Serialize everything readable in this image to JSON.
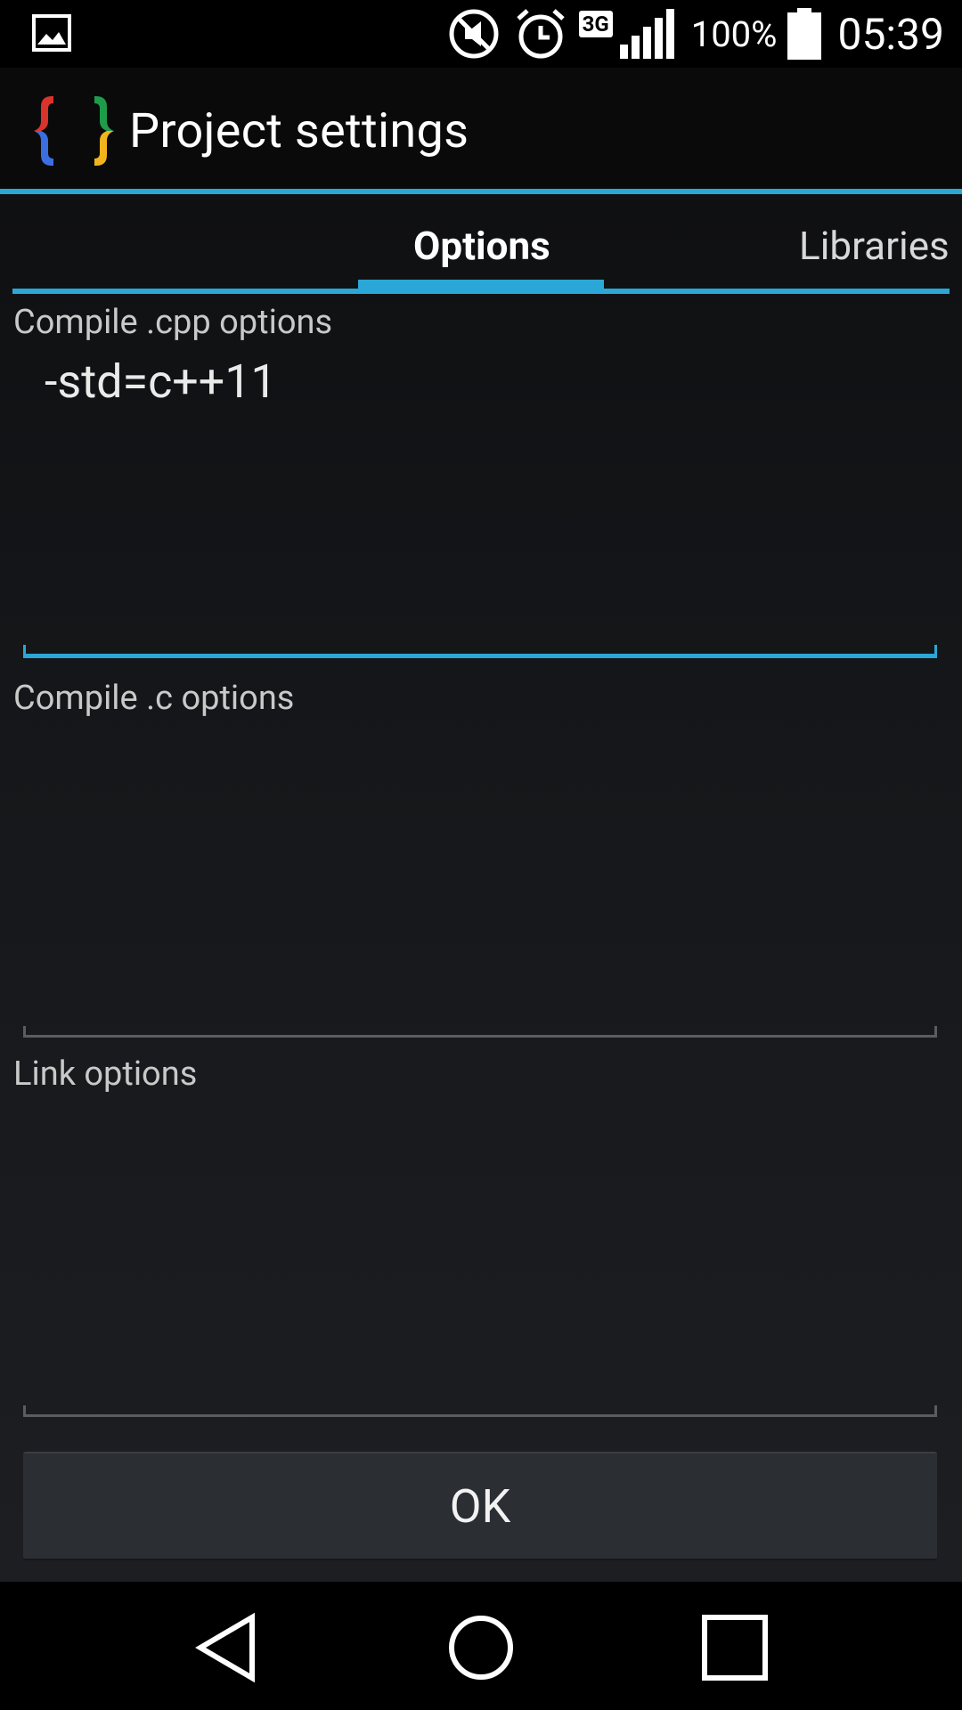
{
  "status_bar": {
    "battery_percent": "100%",
    "time": "05:39",
    "network": "3G",
    "icons": [
      "gallery-icon",
      "mute-icon",
      "alarm-icon",
      "network-3g-icon",
      "signal-icon",
      "battery-icon"
    ]
  },
  "action_bar": {
    "title": "Project settings",
    "logo_icon": "braces-logo-icon"
  },
  "tabs": [
    {
      "label": "Options",
      "selected": true
    },
    {
      "label": "Libraries",
      "selected": false
    }
  ],
  "fields": {
    "compile_cpp": {
      "label": "Compile .cpp options",
      "value": "-std=c++11"
    },
    "compile_c": {
      "label": "Compile .c options",
      "value": ""
    },
    "link": {
      "label": "Link options",
      "value": ""
    }
  },
  "ok_button": {
    "label": "OK"
  },
  "colors": {
    "accent": "#2aa7d6",
    "background": "#15171a",
    "logo_red": "#d9342b",
    "logo_green": "#1e9b4a",
    "logo_blue": "#3b6fe0",
    "logo_yellow": "#f2b41c"
  },
  "nav_bar": {
    "icons": [
      "back-icon",
      "home-icon",
      "recents-icon"
    ]
  }
}
